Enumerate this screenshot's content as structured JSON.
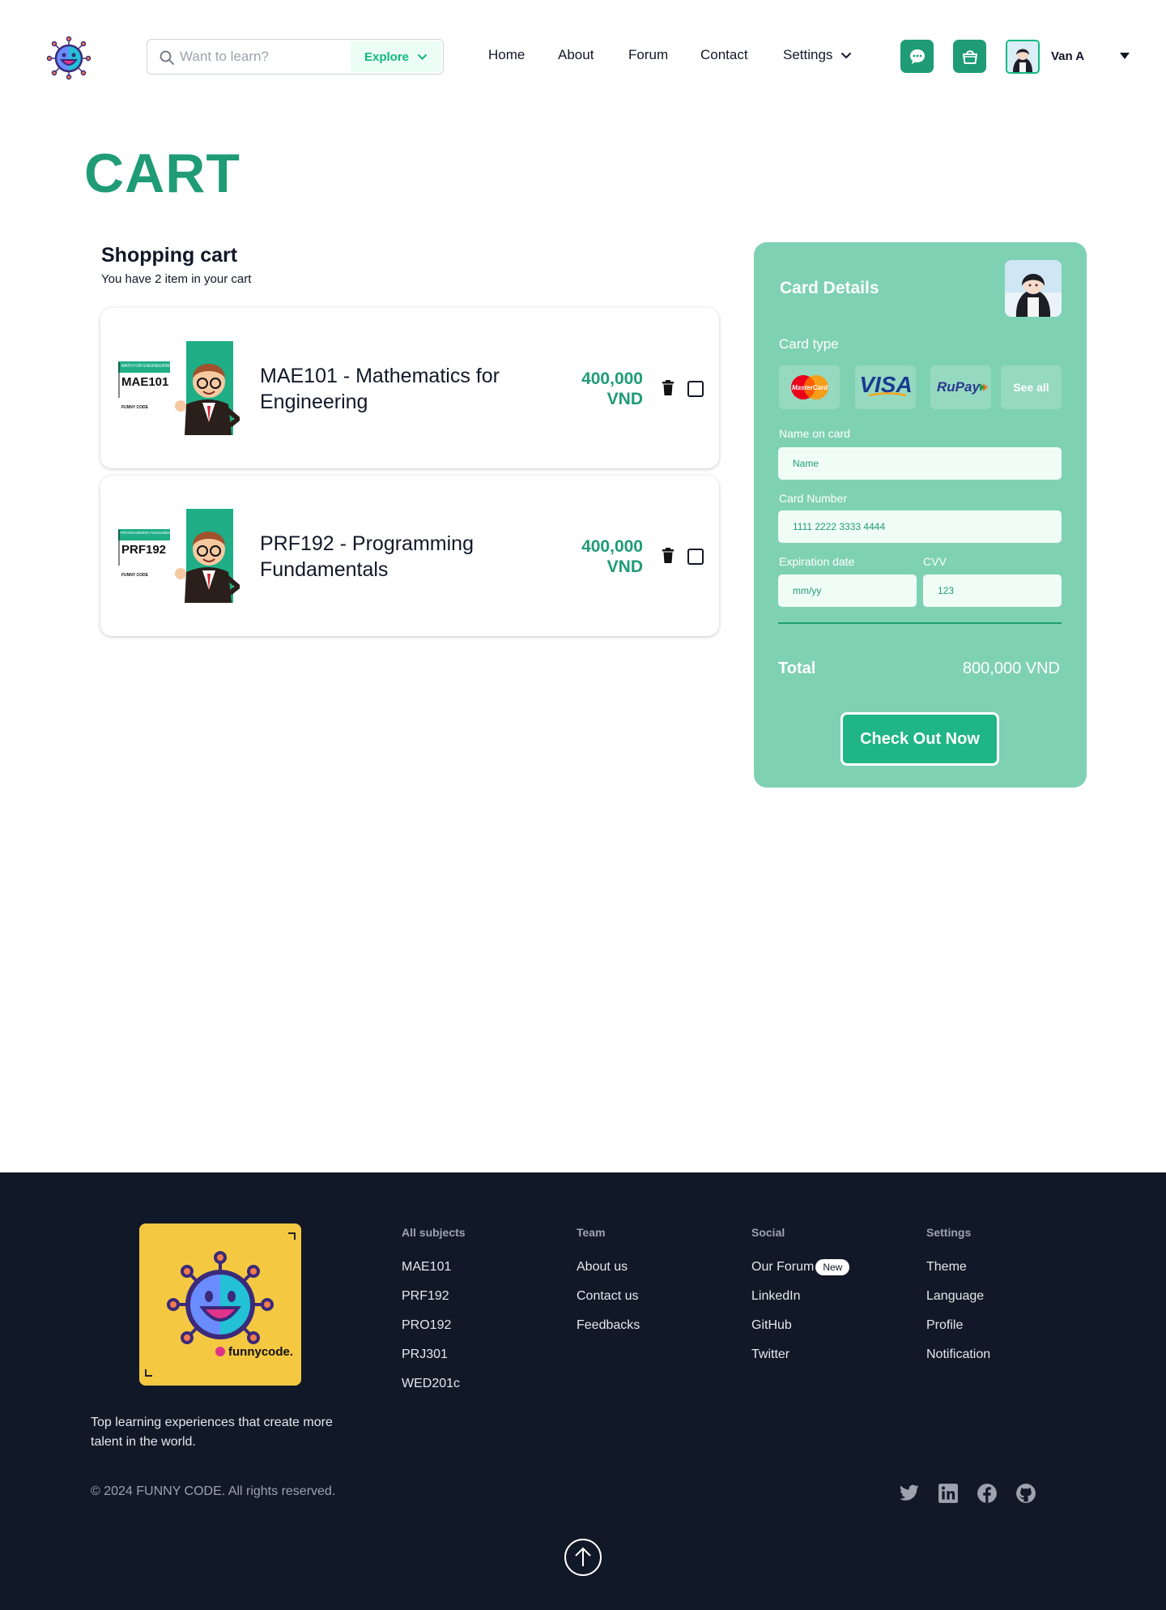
{
  "header": {
    "search_placeholder": "Want to learn?",
    "explore_label": "Explore",
    "nav": {
      "home": "Home",
      "about": "About",
      "forum": "Forum",
      "contact": "Contact",
      "settings": "Settings"
    },
    "username": "Van A"
  },
  "page_title": "CART",
  "cart": {
    "heading": "Shopping cart",
    "subheading": "You have 2 item in your cart",
    "items": [
      {
        "code": "MAE101",
        "tag": "MATH FOR ENGINEERING",
        "name": "MAE101 - Mathematics for Engineering",
        "price": "400,000 VND",
        "brand": "FUNNY CODE"
      },
      {
        "code": "PRF192",
        "tag": "PROGRAMMING FUNDAMENTALS",
        "name": "PRF192 - Programming Fundamentals",
        "price": "400,000 VND",
        "brand": "FUNNY CODE"
      }
    ]
  },
  "card_details": {
    "title": "Card Details",
    "card_type_label": "Card type",
    "card_types": [
      "MasterCard",
      "VISA",
      "RuPay",
      "See all"
    ],
    "name_label": "Name on card",
    "name_placeholder": "Name",
    "number_label": "Card Number",
    "number_placeholder": "1111 2222 3333 4444",
    "exp_label": "Expiration date",
    "exp_placeholder": "mm/yy",
    "cvv_label": "CVV",
    "cvv_placeholder": "123",
    "total_label": "Total",
    "total_value": "800,000 VND",
    "checkout_label": "Check Out Now"
  },
  "footer": {
    "tagline": "Top learning experiences that create more talent in the world.",
    "columns": {
      "subjects": {
        "title": "All subjects",
        "links": [
          "MAE101",
          "PRF192",
          "PRO192",
          "PRJ301",
          "WED201c"
        ]
      },
      "team": {
        "title": "Team",
        "links": [
          "About us",
          "Contact us",
          "Feedbacks"
        ]
      },
      "social": {
        "title": "Social",
        "links": [
          "Our Forum",
          "LinkedIn",
          "GitHub",
          "Twitter"
        ],
        "badge": "New"
      },
      "settings": {
        "title": "Settings",
        "links": [
          "Theme",
          "Language",
          "Profile",
          "Notification"
        ]
      }
    },
    "copyright": "© 2024 FUNNY CODE. All rights reserved.",
    "logo_text": "funnycode."
  },
  "colors": {
    "brand": "#1f9c75",
    "panel": "#7fd1b4",
    "footer_bg": "#111827",
    "checkout": "#20b584"
  }
}
